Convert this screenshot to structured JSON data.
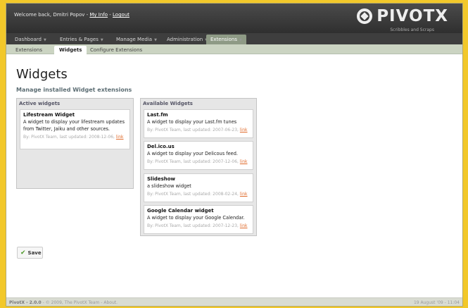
{
  "header": {
    "welcome_prefix": "Welcome back, Dmitri Popov - ",
    "my_info": "My Info",
    "separator": " - ",
    "logout": "Logout",
    "logo": "PIVOTX",
    "tagline": "Scribbles and Scraps"
  },
  "mainnav": [
    {
      "label": "Dashboard"
    },
    {
      "label": "Entries & Pages"
    },
    {
      "label": "Manage Media"
    },
    {
      "label": "Administration"
    },
    {
      "label": "Extensions",
      "active": true
    }
  ],
  "subnav": [
    {
      "label": "Extensions"
    },
    {
      "label": "Widgets",
      "active": true
    },
    {
      "label": "Configure Extensions"
    }
  ],
  "page": {
    "title": "Widgets",
    "subtitle": "Manage installed Widget extensions"
  },
  "active_panel": {
    "heading": "Active widgets",
    "widgets": [
      {
        "name": "Lifestream Widget",
        "description": "A widget to display your lifestream updates from Twitter, Jaiku and other sources.",
        "meta": "By: PivotX Team, last updated: 2008-12-06,",
        "link": "link"
      }
    ]
  },
  "available_panel": {
    "heading": "Available Widgets",
    "widgets": [
      {
        "name": "Last.fm",
        "description": "A widget to display your Last.fm tunes",
        "meta": "By: PivotX Team, last updated: 2007-06-23,",
        "link": "link"
      },
      {
        "name": "Del.ico.us",
        "description": "A widget to display your Delicous feed.",
        "meta": "By: PivotX Team, last updated: 2007-12-06,",
        "link": "link"
      },
      {
        "name": "Slideshow",
        "description": "a slideshow widget",
        "meta": "By: PivotX Team, last updated: 2008-02-24,",
        "link": "link"
      },
      {
        "name": "Google Calendar widget",
        "description": "A widget to display your Google Calendar.",
        "meta": "By: PivotX Team, last updated: 2007-12-23,",
        "link": "link"
      }
    ]
  },
  "save_label": "Save",
  "footer": {
    "version": "PivotX - 2.0.0",
    "copyright": " - © 2009, The PivotX Team - About.",
    "date": "19 August '09 - 11:04"
  },
  "icons": {
    "save": "checkmark-icon",
    "nav_arrow": "chevron-down-icon"
  },
  "colors": {
    "border": "#f2c82a",
    "header": "#3e3e3e",
    "subnav": "#cbd4c2",
    "link": "#e06a2a"
  }
}
